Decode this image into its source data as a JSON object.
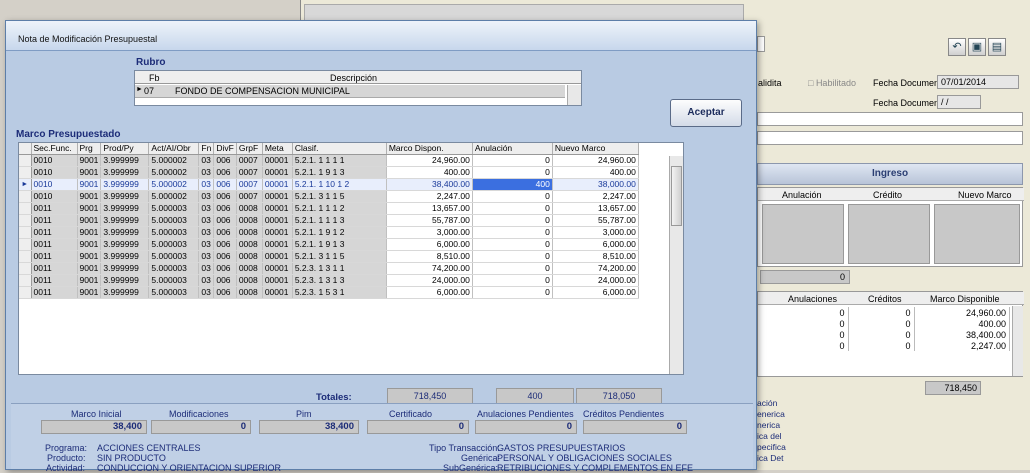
{
  "background_window": {
    "fecha_documento_label": "Fecha Documento",
    "fecha_documento_value": "07/01/2014",
    "fecha_documento2_label": "Fecha Documento",
    "fecha_documento2_value": "/ /",
    "left_label_1": "alidita",
    "left_label_2": "Habilitado",
    "ingreso_header": "Ingreso",
    "ingreso_columns": [
      "Anulación",
      "Crédito",
      "Nuevo Marco"
    ],
    "ingreso_total": "0",
    "lower_columns": [
      "Anulaciones",
      "Créditos",
      "Marco Disponible"
    ],
    "lower_rows": [
      {
        "anul": "0",
        "cred": "0",
        "marco": "24,960.00"
      },
      {
        "anul": "0",
        "cred": "0",
        "marco": "400.00"
      },
      {
        "anul": "0",
        "cred": "0",
        "marco": "38,400.00"
      },
      {
        "anul": "0",
        "cred": "0",
        "marco": "2,247.00"
      }
    ],
    "lower_total": "718,450",
    "side_texts": [
      "ación",
      "enerica",
      "nerica",
      "ica del",
      "pecifica",
      "ica Det"
    ]
  },
  "dialog": {
    "title": "Nota de Modificación Presupuestal",
    "rubro_label": "Rubro",
    "rubro_columns": [
      "Fb",
      "Descripción"
    ],
    "rubro_row": {
      "fb": "07",
      "descripcion": "FONDO DE COMPENSACION MUNICIPAL"
    },
    "accept_button": "Aceptar",
    "marco_label": "Marco Presupuestado",
    "columns": [
      "Sec.Func.",
      "Prg",
      "Prod/Py",
      "Act/AI/Obr",
      "Fn",
      "DivF",
      "GrpF",
      "Meta",
      "Clasif.",
      "Marco Dispon.",
      "Anulación",
      "Nuevo Marco"
    ],
    "rows": [
      {
        "sec": "0010",
        "prg": "9001",
        "prod": "3.999999",
        "act": "5.000002",
        "fn": "03",
        "divf": "006",
        "grpf": "0007",
        "meta": "00001",
        "clasif": "5.2.1.  1  1  1  1",
        "marco": "24,960.00",
        "anul": "0",
        "nuevo": "24,960.00"
      },
      {
        "sec": "0010",
        "prg": "9001",
        "prod": "3.999999",
        "act": "5.000002",
        "fn": "03",
        "divf": "006",
        "grpf": "0007",
        "meta": "00001",
        "clasif": "5.2.1.  1  9  1  3",
        "marco": "400.00",
        "anul": "0",
        "nuevo": "400.00"
      },
      {
        "sec": "0010",
        "prg": "9001",
        "prod": "3.999999",
        "act": "5.000002",
        "fn": "03",
        "divf": "006",
        "grpf": "0007",
        "meta": "00001",
        "clasif": "5.2.1.  1  10  1  2",
        "marco": "38,400.00",
        "anul": "400",
        "nuevo": "38,000.00"
      },
      {
        "sec": "0010",
        "prg": "9001",
        "prod": "3.999999",
        "act": "5.000002",
        "fn": "03",
        "divf": "006",
        "grpf": "0007",
        "meta": "00001",
        "clasif": "5.2.1.  3  1  1  5",
        "marco": "2,247.00",
        "anul": "0",
        "nuevo": "2,247.00"
      },
      {
        "sec": "0011",
        "prg": "9001",
        "prod": "3.999999",
        "act": "5.000003",
        "fn": "03",
        "divf": "006",
        "grpf": "0008",
        "meta": "00001",
        "clasif": "5.2.1.  1  1  1  2",
        "marco": "13,657.00",
        "anul": "0",
        "nuevo": "13,657.00"
      },
      {
        "sec": "0011",
        "prg": "9001",
        "prod": "3.999999",
        "act": "5.000003",
        "fn": "03",
        "divf": "006",
        "grpf": "0008",
        "meta": "00001",
        "clasif": "5.2.1.  1  1  1  3",
        "marco": "55,787.00",
        "anul": "0",
        "nuevo": "55,787.00"
      },
      {
        "sec": "0011",
        "prg": "9001",
        "prod": "3.999999",
        "act": "5.000003",
        "fn": "03",
        "divf": "006",
        "grpf": "0008",
        "meta": "00001",
        "clasif": "5.2.1.  1  9  1  2",
        "marco": "3,000.00",
        "anul": "0",
        "nuevo": "3,000.00"
      },
      {
        "sec": "0011",
        "prg": "9001",
        "prod": "3.999999",
        "act": "5.000003",
        "fn": "03",
        "divf": "006",
        "grpf": "0008",
        "meta": "00001",
        "clasif": "5.2.1.  1  9  1  3",
        "marco": "6,000.00",
        "anul": "0",
        "nuevo": "6,000.00"
      },
      {
        "sec": "0011",
        "prg": "9001",
        "prod": "3.999999",
        "act": "5.000003",
        "fn": "03",
        "divf": "006",
        "grpf": "0008",
        "meta": "00001",
        "clasif": "5.2.1.  3  1  1  5",
        "marco": "8,510.00",
        "anul": "0",
        "nuevo": "8,510.00"
      },
      {
        "sec": "0011",
        "prg": "9001",
        "prod": "3.999999",
        "act": "5.000003",
        "fn": "03",
        "divf": "006",
        "grpf": "0008",
        "meta": "00001",
        "clasif": "5.2.3.  1  3  1  1",
        "marco": "74,200.00",
        "anul": "0",
        "nuevo": "74,200.00"
      },
      {
        "sec": "0011",
        "prg": "9001",
        "prod": "3.999999",
        "act": "5.000003",
        "fn": "03",
        "divf": "006",
        "grpf": "0008",
        "meta": "00001",
        "clasif": "5.2.3.  1  3  1  3",
        "marco": "24,000.00",
        "anul": "0",
        "nuevo": "24,000.00"
      },
      {
        "sec": "0011",
        "prg": "9001",
        "prod": "3.999999",
        "act": "5.000003",
        "fn": "03",
        "divf": "006",
        "grpf": "0008",
        "meta": "00001",
        "clasif": "5.2.3.  1  5  3  1",
        "marco": "6,000.00",
        "anul": "0",
        "nuevo": "6,000.00"
      }
    ],
    "totals_label": "Totales:",
    "totals": {
      "marco": "718,450",
      "anul": "400",
      "nuevo": "718,050"
    },
    "summary": {
      "marco_inicial_label": "Marco Inicial",
      "marco_inicial_value": "38,400",
      "modificaciones_label": "Modificaciones",
      "modificaciones_value": "0",
      "pim_label": "Pim",
      "pim_value": "38,400",
      "certificado_label": "Certificado",
      "certificado_value": "0",
      "anul_pend_label": "Anulaciones Pendientes",
      "anul_pend_value": "0",
      "cred_pend_label": "Créditos Pendientes",
      "cred_pend_value": "0"
    },
    "details": {
      "programa_label": "Programa:",
      "programa_value": "ACCIONES CENTRALES",
      "producto_label": "Producto:",
      "producto_value": "SIN PRODUCTO",
      "actividad_label": "Actividad:",
      "actividad_value": "CONDUCCION Y ORIENTACION SUPERIOR",
      "tipo_label": "Tipo Transacción:",
      "tipo_value": "GASTOS PRESUPUESTARIOS",
      "generica_label": "Genérica:",
      "generica_value": "PERSONAL Y OBLIGACIONES SOCIALES",
      "subgenerica_label": "SubGenérica:",
      "subgenerica_value": "RETRIBUCIONES Y COMPLEMENTOS EN EFE"
    }
  }
}
